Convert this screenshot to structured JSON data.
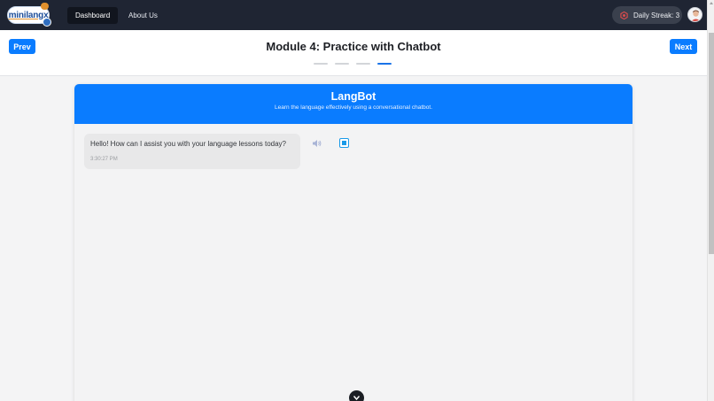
{
  "navbar": {
    "logo_text": "minilangx",
    "links": [
      {
        "label": "Dashboard"
      },
      {
        "label": "About Us"
      }
    ],
    "streak": {
      "label": "Daily Streak: 3"
    }
  },
  "module": {
    "prev_label": "Prev",
    "next_label": "Next",
    "title": "Module 4: Practice with Chatbot",
    "steps_total": 4,
    "current_step": 4
  },
  "chat": {
    "title": "LangBot",
    "subtitle": "Learn the language effectively using a conversational chatbot.",
    "messages": [
      {
        "text": "Hello! How can I assist you with your language lessons today?",
        "time": "3:30:27 PM"
      }
    ]
  },
  "colors": {
    "accent": "#0a7cff",
    "navbar": "#1f2533"
  }
}
